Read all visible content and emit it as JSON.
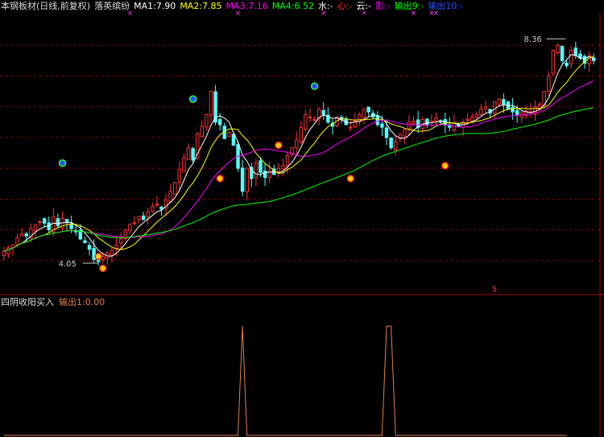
{
  "header": {
    "items": [
      {
        "text": "本钢板材(日线,前复权)",
        "color": "#dcdcdc"
      },
      {
        "text": "落英缤纷",
        "color": "#dcdcdc"
      },
      {
        "text": "MA1:7.90",
        "color": "#ffffff"
      },
      {
        "text": "MA2:7.85",
        "color": "#ffff00"
      },
      {
        "text": "MA3:7.16",
        "color": "#ff00ff"
      },
      {
        "text": "MA4:6.52",
        "color": "#00ff00"
      },
      {
        "text": "水:-",
        "color": "#ffffff"
      },
      {
        "text": "心:-",
        "color": "#ff3030"
      },
      {
        "text": "云:-",
        "color": "#ffffff"
      },
      {
        "text": "影:-",
        "color": "#ff00ff"
      },
      {
        "text": "输出9:-",
        "color": "#00ff00"
      },
      {
        "text": "输出10:-",
        "color": "#3050ff"
      }
    ]
  },
  "sub_header": {
    "items": [
      {
        "text": "四阴收阳买入",
        "color": "#dcdcdc"
      },
      {
        "text": "输出1:0.00",
        "color": "#e08050"
      }
    ]
  },
  "colors": {
    "up": "#ff3232",
    "down": "#54fcfc",
    "ma1": "#ffffff",
    "ma2": "#ffff00",
    "ma3": "#ff00ff",
    "ma4": "#00ff00",
    "grid": "#8b0000",
    "sub_line": "#e08050"
  },
  "chart_data": [
    {
      "type": "candlestick",
      "title": "本钢板材(日线,前复权)",
      "ylim": [
        3.5,
        8.9
      ],
      "max_label": "8.36",
      "min_label": "4.05",
      "max_index": 123,
      "min_index": 20,
      "series": [
        {
          "name": "MA1",
          "value": 7.9
        },
        {
          "name": "MA2",
          "value": 7.85
        },
        {
          "name": "MA3",
          "value": 7.16
        },
        {
          "name": "MA4",
          "value": 6.52
        }
      ],
      "closes": [
        4.28,
        4.35,
        4.4,
        4.55,
        4.62,
        4.58,
        4.72,
        4.8,
        4.86,
        4.83,
        4.7,
        4.95,
        4.78,
        4.92,
        4.85,
        4.72,
        4.66,
        4.52,
        4.45,
        4.32,
        4.12,
        4.08,
        4.18,
        4.25,
        4.3,
        4.4,
        4.52,
        4.7,
        4.8,
        4.84,
        4.96,
        4.9,
        5.05,
        5.15,
        5.2,
        5.1,
        5.28,
        5.45,
        5.62,
        5.88,
        6.1,
        6.3,
        6.06,
        6.58,
        6.72,
        6.95,
        7.4,
        6.8,
        6.75,
        6.48,
        6.6,
        6.35,
        5.9,
        5.45,
        5.9,
        5.7,
        6.0,
        5.82,
        5.72,
        5.85,
        5.78,
        5.9,
        5.95,
        6.15,
        6.3,
        6.45,
        6.7,
        6.95,
        6.9,
        6.85,
        7.05,
        6.95,
        6.8,
        6.72,
        6.9,
        6.85,
        6.75,
        6.7,
        6.82,
        6.95,
        7.05,
        7.0,
        6.9,
        6.75,
        6.7,
        6.5,
        6.3,
        6.42,
        6.55,
        6.65,
        6.8,
        6.82,
        6.7,
        6.85,
        6.75,
        6.82,
        6.88,
        6.8,
        6.75,
        6.7,
        6.78,
        6.72,
        6.8,
        6.86,
        6.9,
        6.95,
        7.05,
        7.1,
        6.98,
        7.2,
        7.25,
        7.15,
        7.05,
        7.0,
        6.95,
        6.98,
        7.02,
        7.0,
        7.1,
        7.15,
        7.4,
        7.7,
        8.2,
        8.3,
        8.0,
        7.9,
        8.2,
        8.1,
        8.05,
        7.95,
        8.1,
        8.0
      ],
      "markers_down": [
        {
          "index": 21,
          "price": 4.18
        },
        {
          "index": 22,
          "price": 3.95
        },
        {
          "index": 48,
          "price": 5.7
        },
        {
          "index": 61,
          "price": 6.35
        },
        {
          "index": 77,
          "price": 5.7
        },
        {
          "index": 98,
          "price": 5.95
        }
      ],
      "markers_up": [
        {
          "index": 13,
          "price": 6.0
        },
        {
          "index": 42,
          "price": 7.25
        },
        {
          "index": 69,
          "price": 7.5
        }
      ],
      "top_marks": [
        28,
        52,
        71,
        80,
        91,
        95,
        96
      ],
      "bottom_mark": {
        "index": 109,
        "text": "$"
      }
    },
    {
      "type": "line",
      "title": "四阴收阳买入",
      "ylim": [
        0,
        1.15
      ],
      "spikes": [
        53,
        85,
        86
      ],
      "n": 126
    }
  ]
}
